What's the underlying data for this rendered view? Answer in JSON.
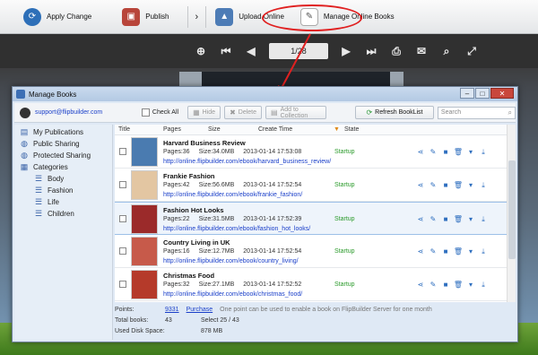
{
  "toolbar": {
    "apply_change": "Apply Change",
    "publish": "Publish",
    "upload_online": "Upload Online",
    "manage_online_books": "Manage Online Books"
  },
  "reader": {
    "page_indicator": "1/28"
  },
  "window": {
    "title": "Manage Books",
    "user_email": "support@flipbuilder.com",
    "check_all": "Check All",
    "hide": "Hide",
    "delete": "Delete",
    "add_to_collection": "Add to Collection",
    "refresh": "Refresh BookList",
    "search_placeholder": "Search"
  },
  "sidebar": {
    "items": [
      {
        "label": "My Publications",
        "icon": "document-icon"
      },
      {
        "label": "Public Sharing",
        "icon": "globe-icon"
      },
      {
        "label": "Protected Sharing",
        "icon": "lock-globe-icon"
      },
      {
        "label": "Categories",
        "icon": "grid-icon"
      }
    ],
    "categories": [
      "Body",
      "Fashion",
      "Life",
      "Children"
    ]
  },
  "columns": {
    "title": "Title",
    "pages": "Pages",
    "size": "Size",
    "create_time": "Create Time",
    "state": "State"
  },
  "books": [
    {
      "title": "Harvard Business Review",
      "pages": "Pages:36",
      "size": "Size:34.0MB",
      "time": "2013-01-14 17:53:08",
      "state": "Startup",
      "url": "http://online.flipbuilder.com/ebook/harvard_business_review/",
      "color": "#4a7bb0"
    },
    {
      "title": "Frankie Fashion",
      "pages": "Pages:42",
      "size": "Size:56.6MB",
      "time": "2013-01-14 17:52:54",
      "state": "Startup",
      "url": "http://online.flipbuilder.com/ebook/frankie_fashion/",
      "color": "#e3c6a2"
    },
    {
      "title": "Fashion Hot Looks",
      "pages": "Pages:22",
      "size": "Size:31.5MB",
      "time": "2013-01-14 17:52:39",
      "state": "Startup",
      "url": "http://online.flipbuilder.com/ebook/fashion_hot_looks/",
      "color": "#9b2a2a"
    },
    {
      "title": "Country Living in UK",
      "pages": "Pages:16",
      "size": "Size:12.7MB",
      "time": "2013-01-14 17:52:54",
      "state": "Startup",
      "url": "http://online.flipbuilder.com/ebook/country_living/",
      "color": "#c75a4a"
    },
    {
      "title": "Christmas Food",
      "pages": "Pages:32",
      "size": "Size:27.1MB",
      "time": "2013-01-14 17:52:52",
      "state": "Startup",
      "url": "http://online.flipbuilder.com/ebook/christmas_food/",
      "color": "#b53a2a"
    }
  ],
  "footer": {
    "points_label": "Points:",
    "points_value": "9331",
    "purchase": "Purchase",
    "points_note": "One point can be used to enable a book on FlipBuilder Server for one month",
    "total_label": "Total books:",
    "total_value": "43",
    "select_text": "Select 25 / 43",
    "disk_label": "Used Disk Space:",
    "disk_value": "878 MB"
  }
}
